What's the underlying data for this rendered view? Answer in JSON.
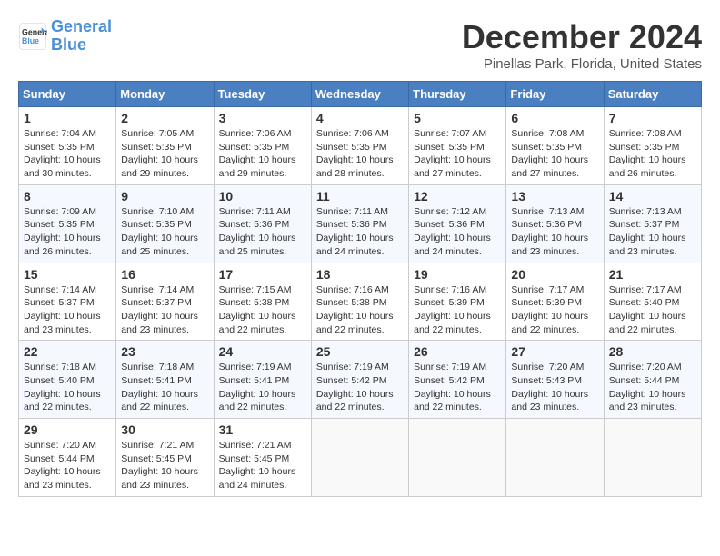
{
  "logo": {
    "line1": "General",
    "line2": "Blue"
  },
  "title": "December 2024",
  "location": "Pinellas Park, Florida, United States",
  "days_of_week": [
    "Sunday",
    "Monday",
    "Tuesday",
    "Wednesday",
    "Thursday",
    "Friday",
    "Saturday"
  ],
  "weeks": [
    [
      {
        "day": "1",
        "info": "Sunrise: 7:04 AM\nSunset: 5:35 PM\nDaylight: 10 hours\nand 30 minutes."
      },
      {
        "day": "2",
        "info": "Sunrise: 7:05 AM\nSunset: 5:35 PM\nDaylight: 10 hours\nand 29 minutes."
      },
      {
        "day": "3",
        "info": "Sunrise: 7:06 AM\nSunset: 5:35 PM\nDaylight: 10 hours\nand 29 minutes."
      },
      {
        "day": "4",
        "info": "Sunrise: 7:06 AM\nSunset: 5:35 PM\nDaylight: 10 hours\nand 28 minutes."
      },
      {
        "day": "5",
        "info": "Sunrise: 7:07 AM\nSunset: 5:35 PM\nDaylight: 10 hours\nand 27 minutes."
      },
      {
        "day": "6",
        "info": "Sunrise: 7:08 AM\nSunset: 5:35 PM\nDaylight: 10 hours\nand 27 minutes."
      },
      {
        "day": "7",
        "info": "Sunrise: 7:08 AM\nSunset: 5:35 PM\nDaylight: 10 hours\nand 26 minutes."
      }
    ],
    [
      {
        "day": "8",
        "info": "Sunrise: 7:09 AM\nSunset: 5:35 PM\nDaylight: 10 hours\nand 26 minutes."
      },
      {
        "day": "9",
        "info": "Sunrise: 7:10 AM\nSunset: 5:35 PM\nDaylight: 10 hours\nand 25 minutes."
      },
      {
        "day": "10",
        "info": "Sunrise: 7:11 AM\nSunset: 5:36 PM\nDaylight: 10 hours\nand 25 minutes."
      },
      {
        "day": "11",
        "info": "Sunrise: 7:11 AM\nSunset: 5:36 PM\nDaylight: 10 hours\nand 24 minutes."
      },
      {
        "day": "12",
        "info": "Sunrise: 7:12 AM\nSunset: 5:36 PM\nDaylight: 10 hours\nand 24 minutes."
      },
      {
        "day": "13",
        "info": "Sunrise: 7:13 AM\nSunset: 5:36 PM\nDaylight: 10 hours\nand 23 minutes."
      },
      {
        "day": "14",
        "info": "Sunrise: 7:13 AM\nSunset: 5:37 PM\nDaylight: 10 hours\nand 23 minutes."
      }
    ],
    [
      {
        "day": "15",
        "info": "Sunrise: 7:14 AM\nSunset: 5:37 PM\nDaylight: 10 hours\nand 23 minutes."
      },
      {
        "day": "16",
        "info": "Sunrise: 7:14 AM\nSunset: 5:37 PM\nDaylight: 10 hours\nand 23 minutes."
      },
      {
        "day": "17",
        "info": "Sunrise: 7:15 AM\nSunset: 5:38 PM\nDaylight: 10 hours\nand 22 minutes."
      },
      {
        "day": "18",
        "info": "Sunrise: 7:16 AM\nSunset: 5:38 PM\nDaylight: 10 hours\nand 22 minutes."
      },
      {
        "day": "19",
        "info": "Sunrise: 7:16 AM\nSunset: 5:39 PM\nDaylight: 10 hours\nand 22 minutes."
      },
      {
        "day": "20",
        "info": "Sunrise: 7:17 AM\nSunset: 5:39 PM\nDaylight: 10 hours\nand 22 minutes."
      },
      {
        "day": "21",
        "info": "Sunrise: 7:17 AM\nSunset: 5:40 PM\nDaylight: 10 hours\nand 22 minutes."
      }
    ],
    [
      {
        "day": "22",
        "info": "Sunrise: 7:18 AM\nSunset: 5:40 PM\nDaylight: 10 hours\nand 22 minutes."
      },
      {
        "day": "23",
        "info": "Sunrise: 7:18 AM\nSunset: 5:41 PM\nDaylight: 10 hours\nand 22 minutes."
      },
      {
        "day": "24",
        "info": "Sunrise: 7:19 AM\nSunset: 5:41 PM\nDaylight: 10 hours\nand 22 minutes."
      },
      {
        "day": "25",
        "info": "Sunrise: 7:19 AM\nSunset: 5:42 PM\nDaylight: 10 hours\nand 22 minutes."
      },
      {
        "day": "26",
        "info": "Sunrise: 7:19 AM\nSunset: 5:42 PM\nDaylight: 10 hours\nand 22 minutes."
      },
      {
        "day": "27",
        "info": "Sunrise: 7:20 AM\nSunset: 5:43 PM\nDaylight: 10 hours\nand 23 minutes."
      },
      {
        "day": "28",
        "info": "Sunrise: 7:20 AM\nSunset: 5:44 PM\nDaylight: 10 hours\nand 23 minutes."
      }
    ],
    [
      {
        "day": "29",
        "info": "Sunrise: 7:20 AM\nSunset: 5:44 PM\nDaylight: 10 hours\nand 23 minutes."
      },
      {
        "day": "30",
        "info": "Sunrise: 7:21 AM\nSunset: 5:45 PM\nDaylight: 10 hours\nand 23 minutes."
      },
      {
        "day": "31",
        "info": "Sunrise: 7:21 AM\nSunset: 5:45 PM\nDaylight: 10 hours\nand 24 minutes."
      },
      {
        "day": "",
        "info": ""
      },
      {
        "day": "",
        "info": ""
      },
      {
        "day": "",
        "info": ""
      },
      {
        "day": "",
        "info": ""
      }
    ]
  ]
}
